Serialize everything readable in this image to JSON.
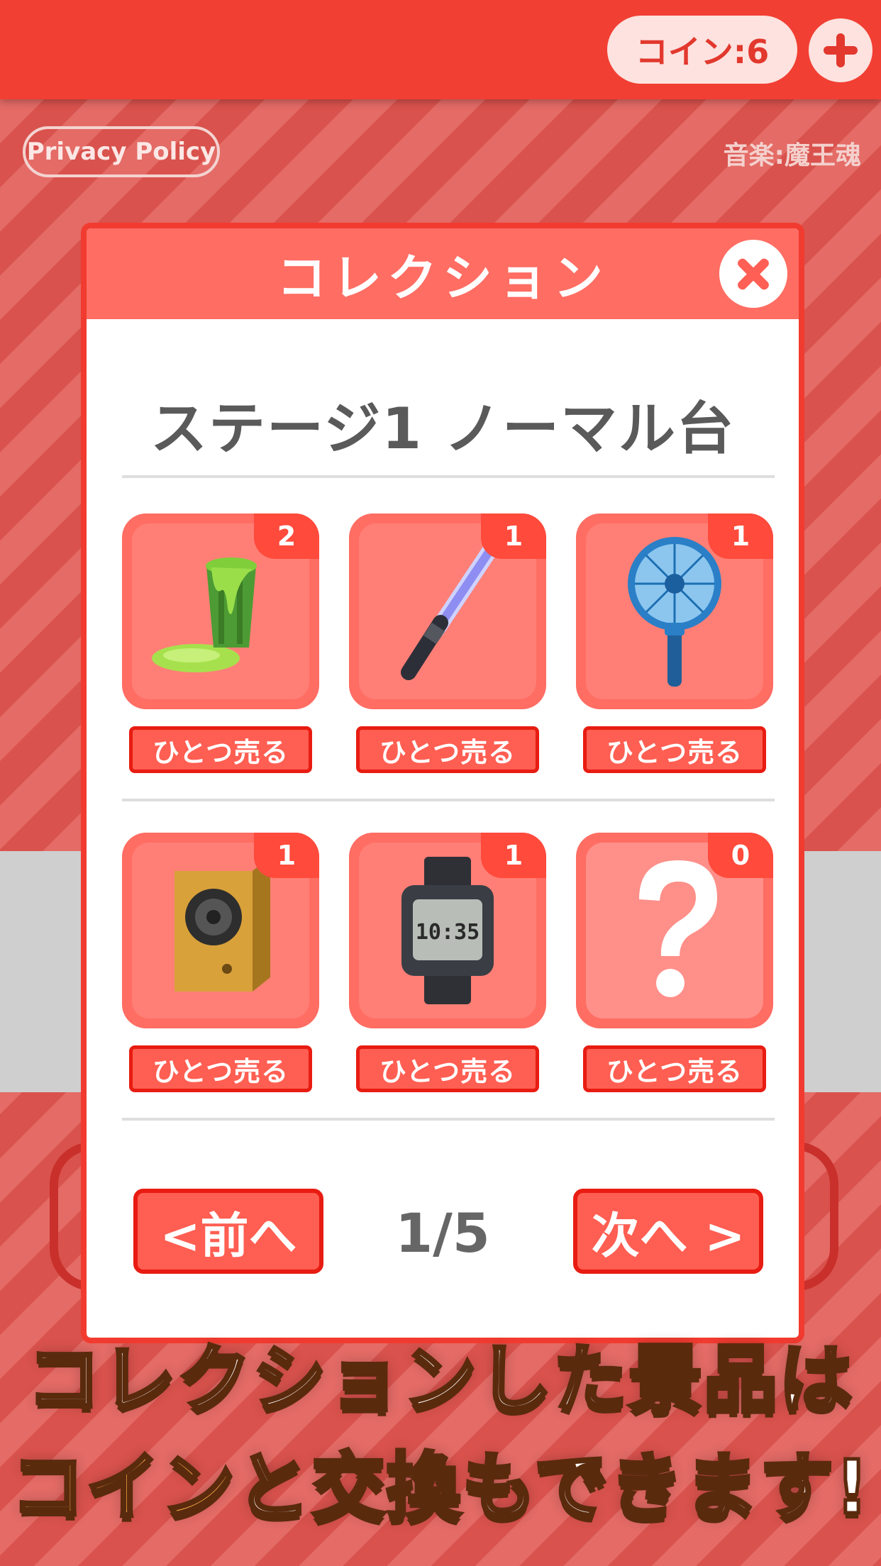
{
  "header": {
    "coin_text": "コイン:6",
    "add_coin_icon": "plus-icon"
  },
  "privacy_label": "Privacy Policy",
  "music_credit": "音楽:魔王魂",
  "dialog": {
    "title": "コレクション",
    "close_icon": "close-icon",
    "stage_title": "ステージ1 ノーマル台",
    "items": [
      {
        "icon": "slime-bucket",
        "count": "2",
        "sell_label": "ひとつ売る"
      },
      {
        "icon": "light-saber",
        "count": "1",
        "sell_label": "ひとつ売る"
      },
      {
        "icon": "handheld-fan",
        "count": "1",
        "sell_label": "ひとつ売る"
      },
      {
        "icon": "speaker",
        "count": "1",
        "sell_label": "ひとつ売る"
      },
      {
        "icon": "digital-watch",
        "count": "1",
        "sell_label": "ひとつ売る",
        "watch_time": "10:35"
      },
      {
        "icon": "question-mark",
        "count": "0",
        "sell_label": "ひとつ売る"
      }
    ],
    "prev_label": "<前へ",
    "page_indicator": "1/5",
    "next_label": "次へ >"
  },
  "promo": {
    "line1_a": "コレクションした",
    "line1_b": "景品",
    "line1_c": "は",
    "line2_a": "コイン",
    "line2_b": "と",
    "line2_c": "交換",
    "line2_d": "もできます!"
  },
  "colors": {
    "topbar": "#f23f33",
    "accent": "#ff6d63",
    "button_border": "#e81c12",
    "promo_highlight": "#ffb04a"
  }
}
